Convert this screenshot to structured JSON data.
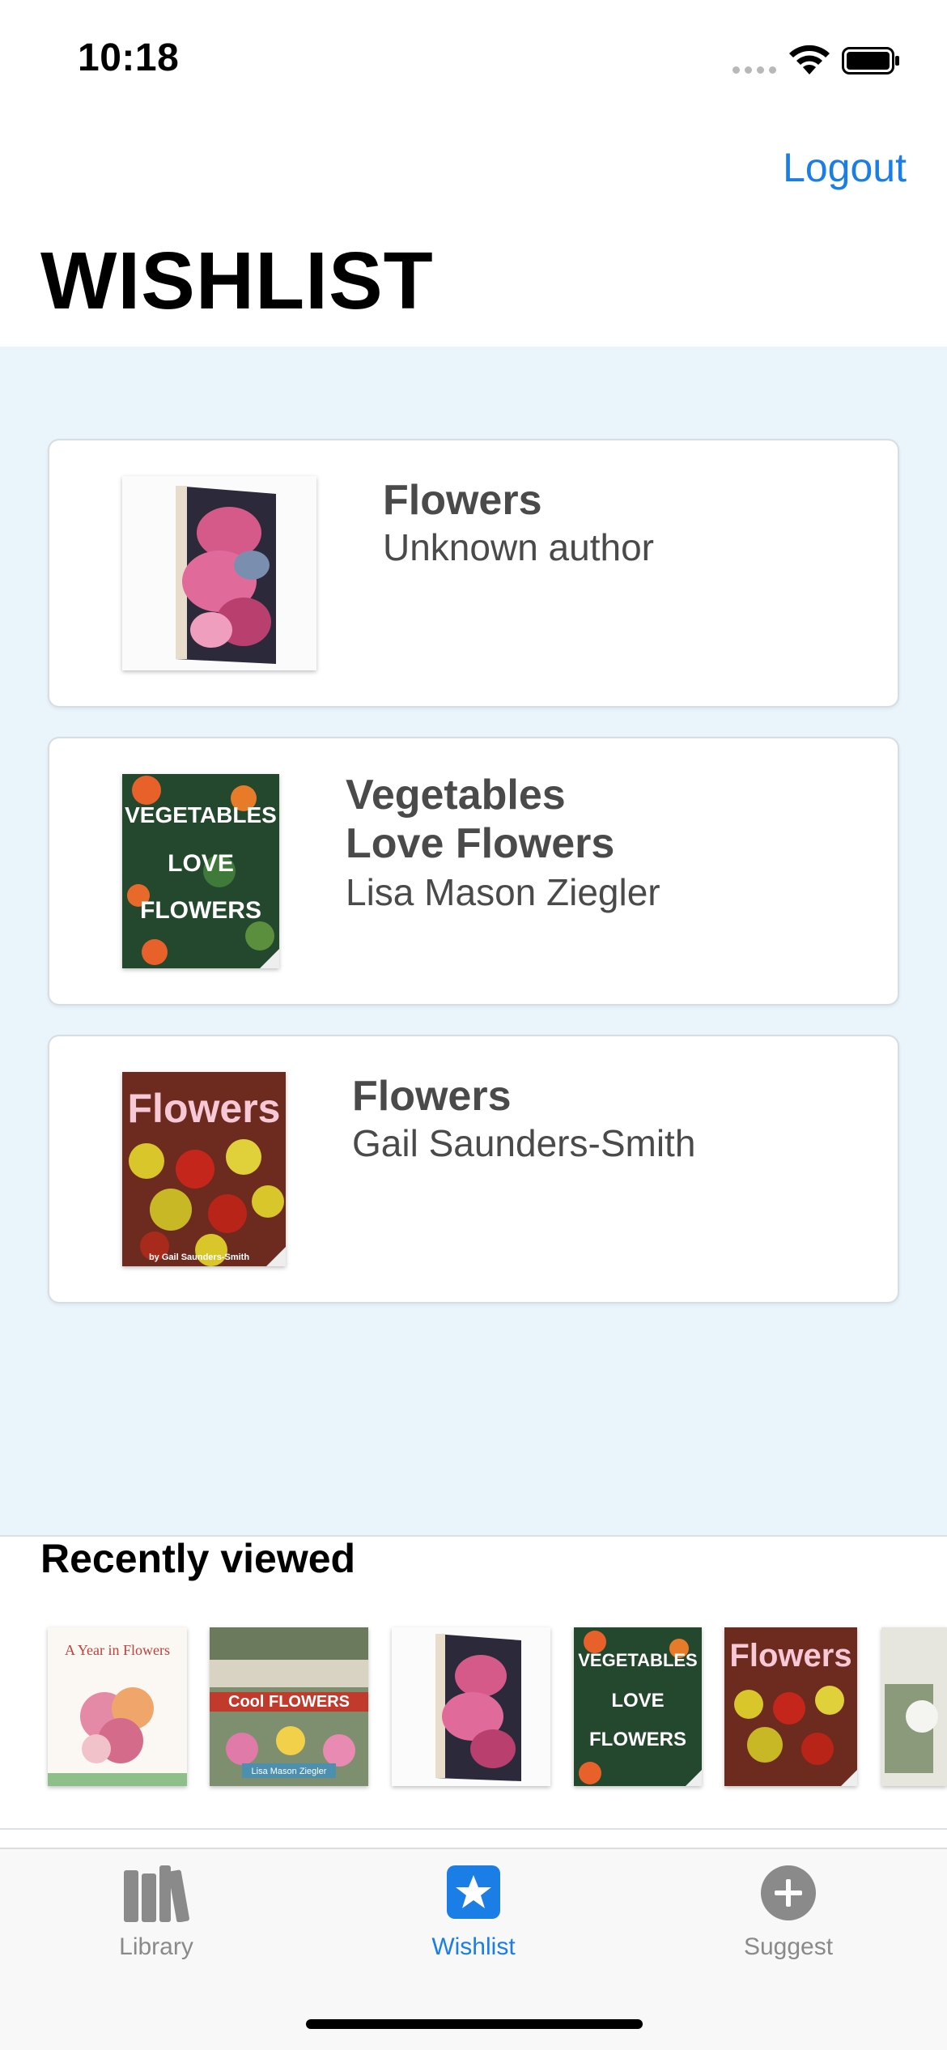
{
  "status_bar": {
    "time": "10:18"
  },
  "header": {
    "logout_label": "Logout",
    "title": "WISHLIST"
  },
  "wishlist": [
    {
      "title": "Flowers",
      "author": "Unknown author"
    },
    {
      "title_line1": "Vegetables",
      "title_line2": "Love Flowers",
      "author": "Lisa Mason Ziegler"
    },
    {
      "title": "Flowers",
      "author": "Gail Saunders-Smith"
    }
  ],
  "cover_texts": {
    "veg_line1": "VEGETABLES",
    "veg_line2": "LOVE",
    "veg_line3": "FLOWERS",
    "flowers": "Flowers",
    "flowers_byline": "by Gail Saunders-Smith",
    "year_title": "A Year in Flowers",
    "cool_title": "Cool FLOWERS",
    "cool_author": "Lisa Mason Ziegler"
  },
  "recent": {
    "title": "Recently viewed"
  },
  "tabs": [
    {
      "label": "Library",
      "icon": "books-icon"
    },
    {
      "label": "Wishlist",
      "icon": "star-icon",
      "active": true
    },
    {
      "label": "Suggest",
      "icon": "plus-circle-icon"
    }
  ],
  "colors": {
    "accent": "#1a7ee6",
    "content_bg": "#e9f4fb",
    "text_muted": "#4a4a4a"
  }
}
